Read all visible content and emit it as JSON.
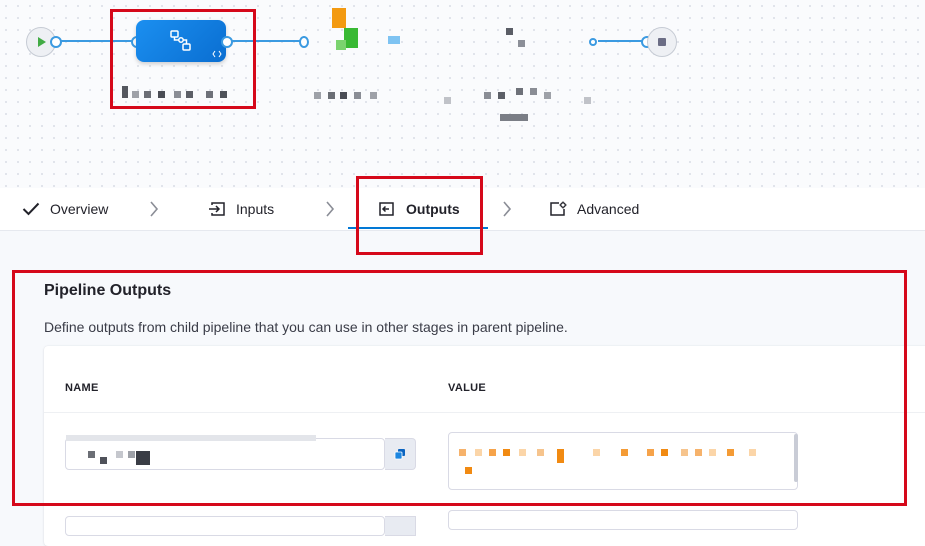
{
  "tabs": [
    {
      "label": "Overview",
      "icon": "check-icon"
    },
    {
      "label": "Inputs",
      "icon": "input-icon"
    },
    {
      "label": "Outputs",
      "icon": "output-icon",
      "active": true
    },
    {
      "label": "Advanced",
      "icon": "advanced-settings-icon"
    }
  ],
  "outputs": {
    "title": "Pipeline Outputs",
    "description": "Define outputs from child pipeline that you can use in other stages in parent pipeline.",
    "columns": {
      "name": "NAME",
      "value": "VALUE"
    }
  },
  "colors": {
    "accent": "#0278d5",
    "highlight": "#d5081a",
    "stage_node": "#1b8ff0",
    "flow_line": "#3b9ae1"
  }
}
